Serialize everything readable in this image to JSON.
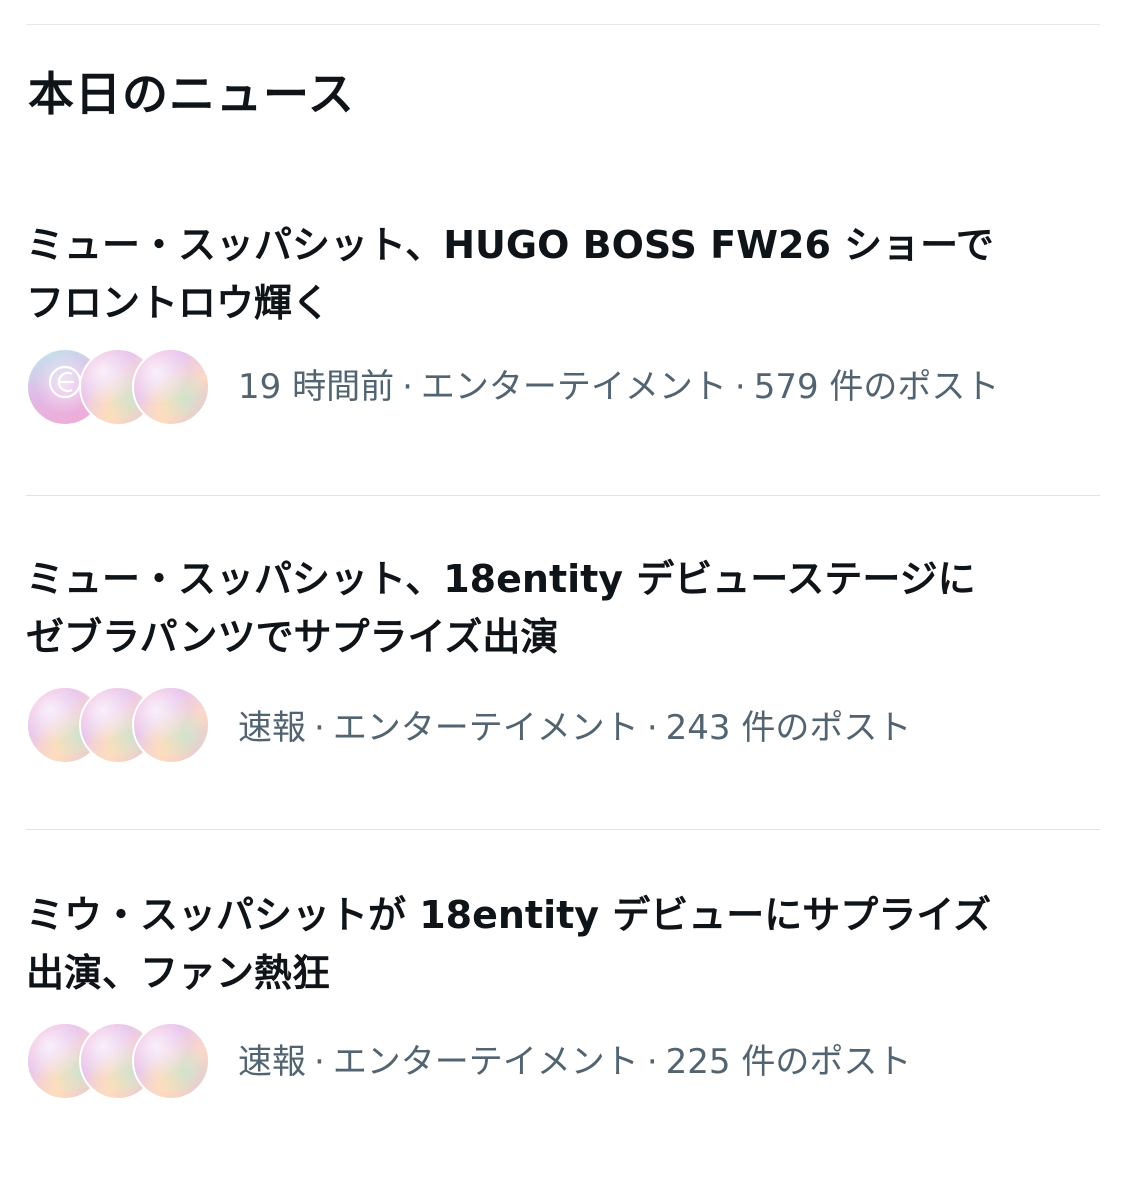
{
  "section": {
    "title": "本日のニュース"
  },
  "news": [
    {
      "headline": "ミュー・スッパシット、HUGO BOSS FW26 ショーで\nフロントロウ輝く",
      "time": "19 時間前",
      "category": "エンターテイメント",
      "posts": "579 件のポスト",
      "avatars": [
        "logo-avatar",
        "pink-iridescent-avatar",
        "pink-iridescent-avatar"
      ]
    },
    {
      "headline": "ミュー・スッパシット、18entity デビューステージに\nゼブラパンツでサプライズ出演",
      "time": "速報",
      "category": "エンターテイメント",
      "posts": "243 件のポスト",
      "avatars": [
        "pink-iridescent-avatar",
        "pink-iridescent-avatar",
        "pink-iridescent-avatar"
      ]
    },
    {
      "headline": "ミウ・スッパシットが 18entity デビューにサプライズ\n出演、ファン熱狂",
      "time": "速報",
      "category": "エンターテイメント",
      "posts": "225 件のポスト",
      "avatars": [
        "pink-iridescent-avatar",
        "pink-iridescent-avatar",
        "pink-iridescent-avatar"
      ]
    }
  ],
  "meta_separator": "·",
  "colors": {
    "text_primary": "#0f1419",
    "text_secondary": "#536471",
    "divider": "#e1e4e7",
    "background": "#ffffff"
  }
}
